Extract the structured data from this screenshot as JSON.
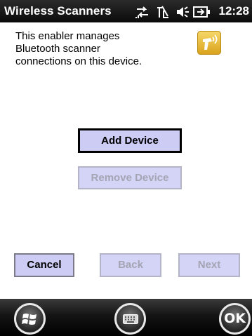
{
  "titlebar": {
    "title": "Wireless Scanners",
    "time": "12:28",
    "icons": [
      "connectivity-icon",
      "signal-off-icon",
      "volume-icon",
      "battery-icon"
    ]
  },
  "content": {
    "description_lines": [
      "This enabler manages",
      "Bluetooth scanner",
      "connections on this device."
    ],
    "app_icon": "bluetooth-scanner-icon",
    "add_device_label": "Add Device",
    "remove_device_label": "Remove Device"
  },
  "nav": {
    "cancel_label": "Cancel",
    "back_label": "Back",
    "next_label": "Next"
  },
  "taskbar": {
    "start_icon": "windows-flag-icon",
    "keyboard_icon": "keyboard-icon",
    "ok_label": "OK"
  },
  "colors": {
    "titlebar": "#111111",
    "button_face": "#ccccf5",
    "disabled_text": "#a4a4b4",
    "app_icon_bg": "#f2c230"
  }
}
